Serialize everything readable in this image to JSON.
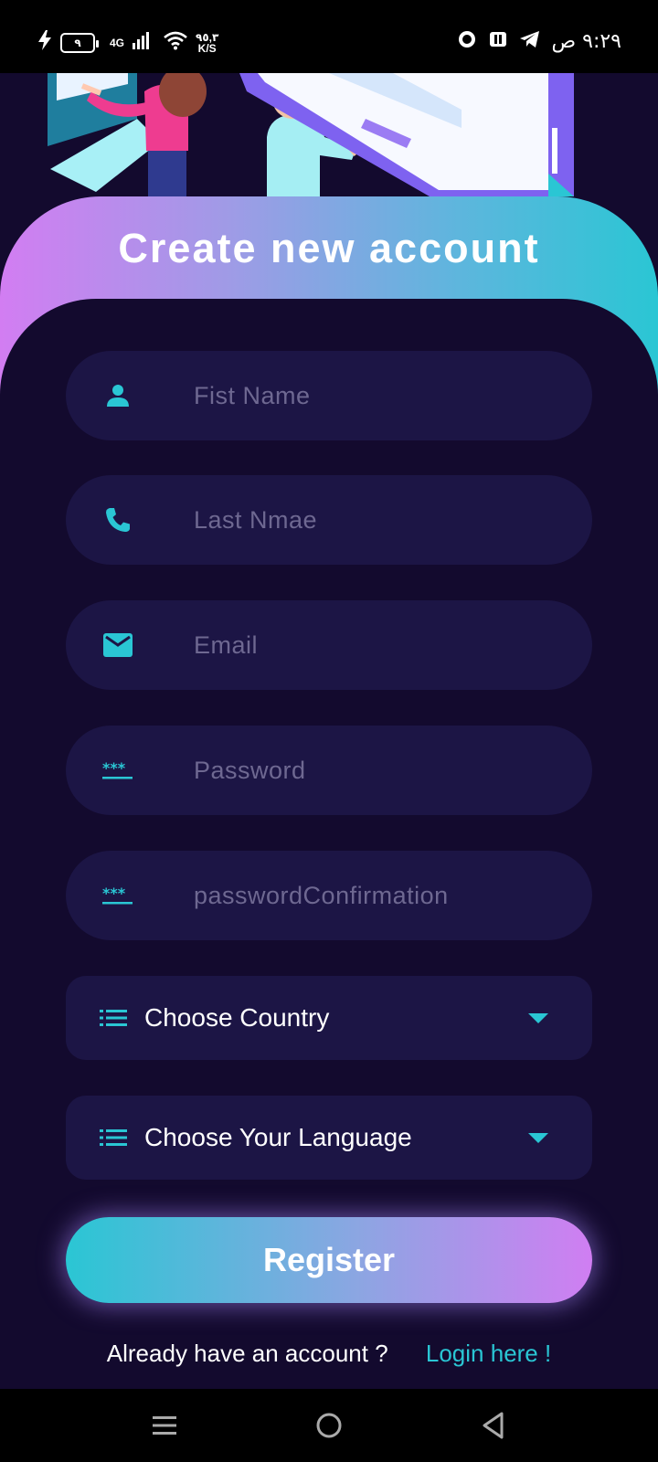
{
  "status_bar": {
    "battery_level": "٩",
    "network": "4G",
    "speed_value": "٩٥,٣",
    "speed_unit": "K/S",
    "time": "٩:٢٩ ص"
  },
  "header": {
    "title": "Create new account"
  },
  "form": {
    "first_name_placeholder": "Fist Name",
    "last_name_placeholder": "Last Nmae",
    "email_placeholder": "Email",
    "password_placeholder": "Password",
    "password_confirmation_placeholder": "passwordConfirmation",
    "country_label": "Choose Country",
    "language_label": "Choose Your Language",
    "register_label": "Register"
  },
  "footer": {
    "question": "Already have an account ?",
    "login_link": "Login here !"
  },
  "colors": {
    "background": "#130a2e",
    "field": "#1c1545",
    "accent_cyan": "#2ac6d4",
    "accent_pink": "#d07ef2"
  }
}
